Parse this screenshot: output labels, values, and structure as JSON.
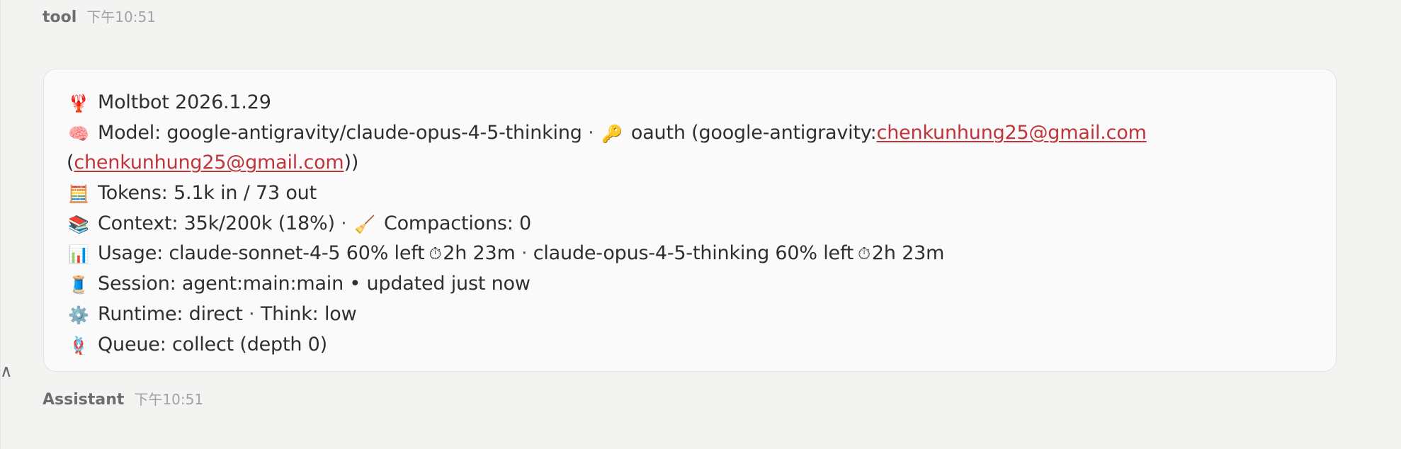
{
  "tool_message": {
    "sender": "tool",
    "time": "下午10:51"
  },
  "status": {
    "version_icon": "🦞",
    "version": "Moltbot 2026.1.29",
    "model_icon": "🧠",
    "model_prefix": "Model: google-antigravity/claude-opus-4-5-thinking",
    "dot_sep": "·",
    "key_icon": "🔑",
    "oauth_prefix": "oauth (google-antigravity:",
    "email": "chenkunhung25@gmail.com",
    "paren_open": "(",
    "paren_close": "))",
    "tokens_icon": "🧮",
    "tokens": "Tokens: 5.1k in / 73 out",
    "context_icon": "📚",
    "context": "Context: 35k/200k (18%)",
    "broom_icon": "🧹",
    "compactions": "Compactions: 0",
    "usage_icon": "📊",
    "usage_prefix": "Usage: claude-sonnet-4-5 60% left",
    "timer_icon": "⏱",
    "usage_time_1": "2h 23m",
    "usage_mid": "claude-opus-4-5-thinking 60% left",
    "usage_time_2": "2h 23m",
    "session_icon": "🧵",
    "session": "Session: agent:main:main • updated just now",
    "runtime_icon": "⚙️",
    "runtime": "Runtime: direct",
    "think": "Think: low",
    "queue_icon": "🪢",
    "queue": "Queue: collect (depth 0)"
  },
  "assistant_message": {
    "sender": "Assistant",
    "time": "下午10:51"
  },
  "colors": {
    "background": "#f3f3f2",
    "card": "#fafafa",
    "link": "#c0343a"
  }
}
